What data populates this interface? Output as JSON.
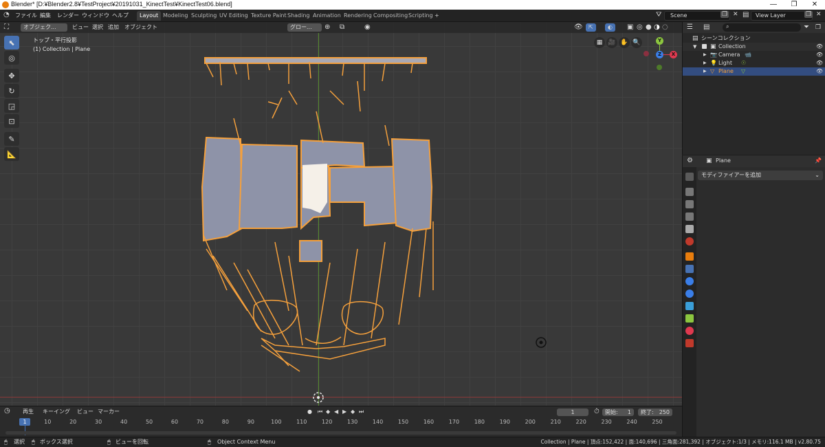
{
  "titlebar": {
    "title": "Blender* [D:¥Blender2.8¥TestProject¥20191031_KinectTest¥KinectTest06.blend]",
    "minimize": "—",
    "restore": "❐",
    "close": "✕"
  },
  "menubar": {
    "items": [
      "ファイル",
      "編集",
      "レンダー",
      "ウィンドウ",
      "ヘルプ"
    ],
    "workspaces": [
      "Layout",
      "Modeling",
      "Sculpting",
      "UV Editing",
      "Texture Paint",
      "Shading",
      "Animation",
      "Rendering",
      "Compositing",
      "Scripting"
    ],
    "active_workspace": "Layout",
    "add_tab": "+",
    "scene": "Scene",
    "view_layer": "View Layer"
  },
  "viewport_header": {
    "mode": "オブジェク...",
    "view": "ビュー",
    "select": "選択",
    "add": "追加",
    "object": "オブジェクト",
    "orientation": "グロー..."
  },
  "viewport": {
    "view_name": "トップ・平行投影",
    "collection_info": "(1) Collection | Plane"
  },
  "gizmo": {
    "y": "Y",
    "z": "Z",
    "x": "X"
  },
  "timeline_header": {
    "playback": "再生",
    "keying": "キーイング",
    "view": "ビュー",
    "marker": "マーカー",
    "current_frame": "1",
    "start_label": "開始:",
    "start": "1",
    "end_label": "終了:",
    "end": "250"
  },
  "timeline": {
    "frames": [
      "1",
      "10",
      "20",
      "30",
      "40",
      "50",
      "60",
      "70",
      "80",
      "90",
      "100",
      "110",
      "120",
      "130",
      "140",
      "150",
      "160",
      "170",
      "180",
      "190",
      "200",
      "210",
      "220",
      "230",
      "240",
      "250"
    ],
    "current": "1"
  },
  "statusbar": {
    "select": "選択",
    "box_select": "ボックス選択",
    "rotate_view": "ビューを回転",
    "context_menu": "Object Context Menu",
    "stats": "Collection | Plane | 頂点:152,422 | 面:140,696 | 三角面:281,392 | オブジェクト:1/3 | メモリ:116.1 MB | v2.80.75"
  },
  "outliner": {
    "root": "シーンコレクション",
    "collection": "Collection",
    "items": [
      "Camera",
      "Light",
      "Plane"
    ]
  },
  "properties": {
    "object_name": "Plane",
    "modifier_add": "モディファイアーを追加"
  },
  "colors": {
    "accent": "#4772b3",
    "selection": "#f5a03c",
    "viewport_bg": "#393939",
    "x_axis": "#e0394f",
    "y_axis": "#8cc63f",
    "z_axis": "#3a7ee8"
  }
}
